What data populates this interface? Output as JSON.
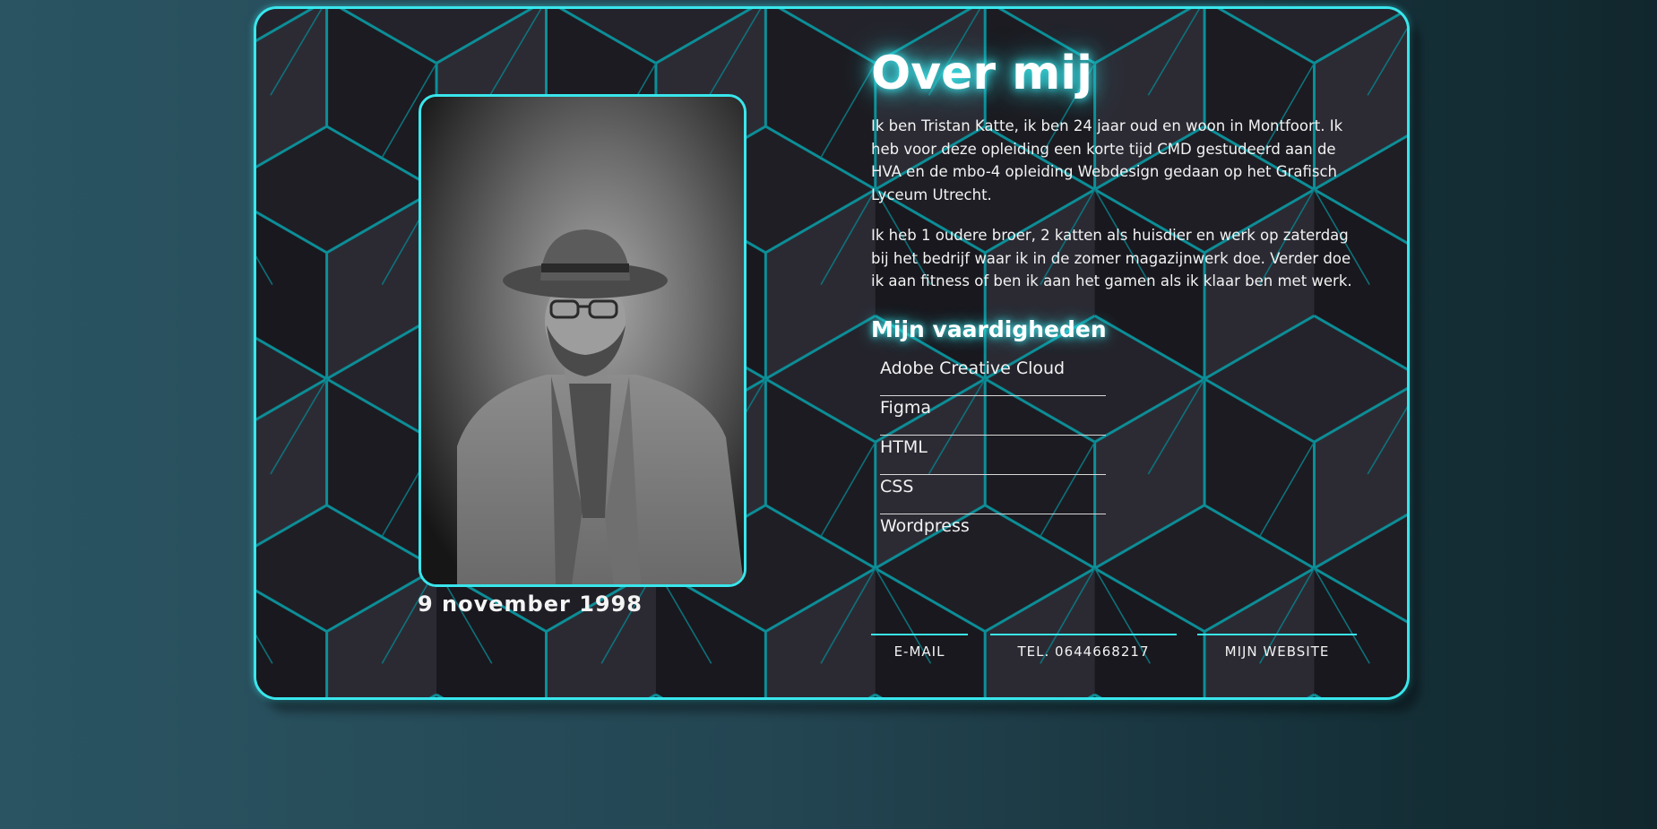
{
  "about": {
    "title": "Over mij",
    "paragraphs": [
      "Ik ben Tristan Katte, ik ben 24 jaar oud en woon in Montfoort. Ik heb voor deze opleiding een korte tijd CMD gestudeerd aan de HVA en de mbo-4 opleiding Webdesign gedaan op het Grafisch Lyceum Utrecht.",
      "Ik heb 1 oudere broer, 2 katten als huisdier en werk op zaterdag bij het bedrijf waar ik in de zomer magazijnwerk doe. Verder doe ik aan fitness of ben ik aan het gamen als ik klaar ben met werk."
    ],
    "birthday": "9 november 1998"
  },
  "skills": {
    "title": "Mijn vaardigheden",
    "items": [
      "Adobe Creative Cloud",
      "Figma",
      "HTML",
      "CSS",
      "Wordpress"
    ]
  },
  "contact": {
    "email_label": "E-MAIL",
    "phone_label": "TEL. 0644668217",
    "website_label": "MIJN WEBSITE"
  },
  "colors": {
    "accent": "#39e6ec",
    "card_background": "#24232b"
  },
  "icons": {
    "profile_photo": "person-photo"
  }
}
